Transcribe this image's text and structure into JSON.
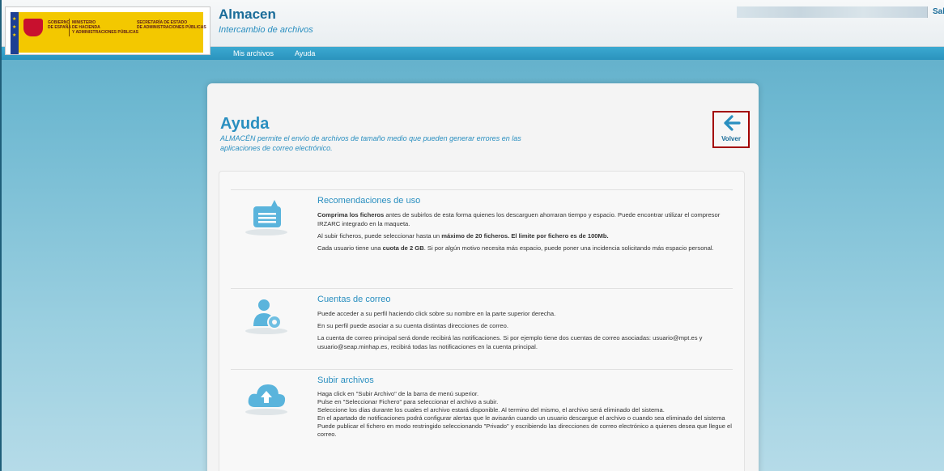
{
  "header": {
    "logo_texts": {
      "gov": "GOBIERNO\nDE ESPAÑA",
      "ministry": "MINISTERIO\nDE HACIENDA\nY ADMINISTRACIONES PÚBLICAS",
      "secretary": "SECRETARÍA DE ESTADO\nDE ADMINISTRACIONES PÚBLICAS"
    },
    "app_title": "Almacen",
    "app_subtitle": "Intercambio de archivos",
    "logout": "Sali"
  },
  "nav": {
    "items": [
      "Mis archivos",
      "Ayuda"
    ]
  },
  "page": {
    "title": "Ayuda",
    "description": "ALMACÉN permite el envío de archivos de tamaño medio que pueden generar errores en las aplicaciones de correo electrónico.",
    "back_label": "Volver"
  },
  "sections": [
    {
      "title": "Recomendaciones de uso",
      "p1_bold": "Comprima los ficheros",
      "p1_rest": " antes de subirlos de esta forma quienes los descarguen ahorraran tiempo y espacio. Puede encontrar utilizar el compresor IRZARC integrado en la maqueta.",
      "p2_pre": "Al subir ficheros, puede seleccionar hasta un ",
      "p2_bold": "máximo de 20 ficheros. El limite por fichero es de 100Mb.",
      "p3_pre": "Cada usuario tiene una ",
      "p3_bold": "cuota de 2 GB",
      "p3_rest": ". Si por algún motivo necesita más espacio, puede poner una incidencia solicitando más espacio personal."
    },
    {
      "title": "Cuentas de correo",
      "p1": "Puede acceder a su perfil haciendo click sobre su nombre en la parte superior derecha.",
      "p2": "En su perfil puede asociar a su cuenta distintas direcciones de correo.",
      "p3": "La cuenta de correo principal será donde recibirá las notificaciones. Si por ejemplo tiene dos cuentas de correo asociadas: usuario@mpt.es y usuario@seap.minhap.es, recibirá todas las notificaciones en la cuenta principal."
    },
    {
      "title": "Subir archivos",
      "lines": [
        "Haga click en \"Subir Archivo\" de la barra de menú superior.",
        "Pulse en \"Seleccionar Fichero\" para seleccionar el archivo a subir.",
        "Seleccione los días durante los cuales el archivo estará disponible. Al termino del mismo, el archivo será eliminado del sistema.",
        "En el apartado de notificaciones podrá configurar alertas que le avisarán cuando un usuario descargue el archivo o cuando sea eliminado del sistema",
        "Puede publicar el fichero en modo restringido seleccionando \"Privado\" y escribiendo las direcciones de correo electrónico a quienes desea que llegue el correo."
      ]
    }
  ],
  "colors": {
    "accent": "#2a8fc0",
    "nav": "#2b93bd",
    "back_border": "#a30000"
  }
}
